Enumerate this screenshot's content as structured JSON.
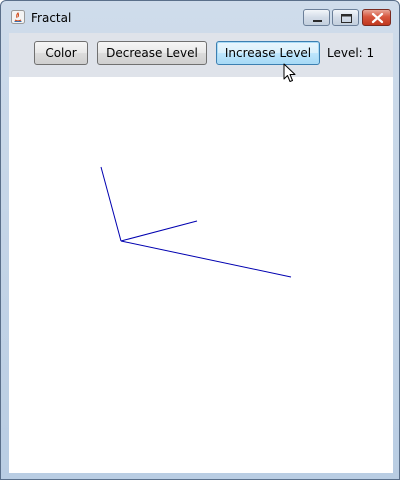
{
  "window": {
    "title": "Fractal",
    "controls": {
      "minimize": "minimize-icon",
      "maximize": "maximize-icon",
      "close": "close-icon"
    }
  },
  "toolbar": {
    "color_label": "Color",
    "decrease_label": "Decrease Level",
    "increase_label": "Increase Level",
    "level_text": "Level: 1"
  },
  "fractal": {
    "level": 1,
    "line_color": "#0000b0"
  }
}
